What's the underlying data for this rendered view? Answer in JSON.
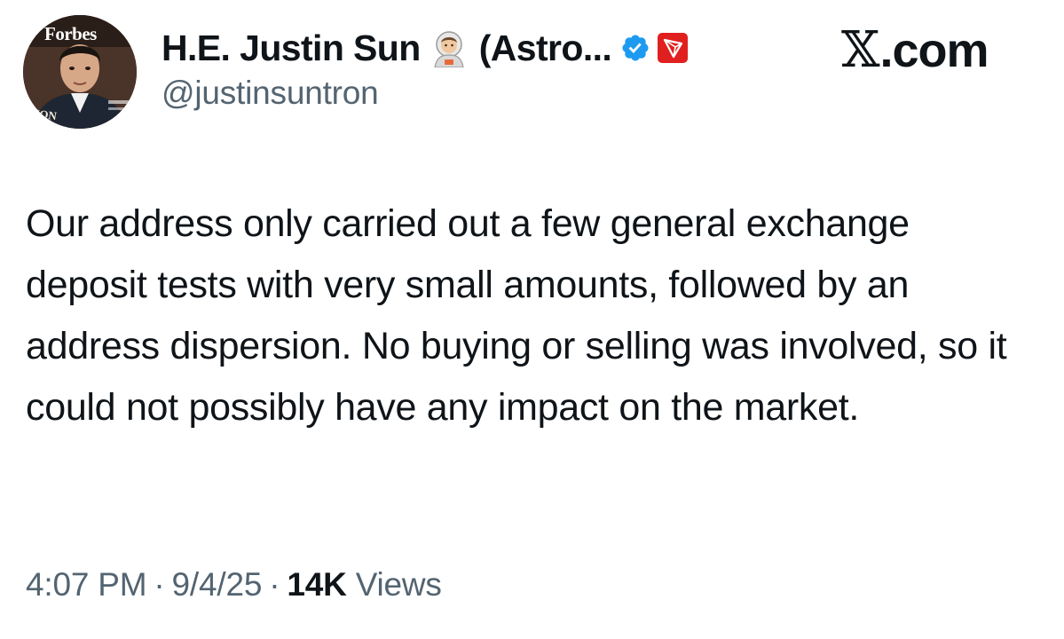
{
  "author": {
    "display_name": "H.E. Justin Sun",
    "name_suffix": "(Astro...",
    "handle": "@justinsuntron",
    "avatar": {
      "masthead": "Forbes",
      "cover_text": "RION"
    },
    "emoji_icon": "astronaut-emoji-icon",
    "verified_icon": "verified-badge-icon",
    "affiliate_icon": "tron-logo-icon"
  },
  "brand": {
    "glyph": "𝕏",
    "label": ".com"
  },
  "tweet": {
    "text": "Our address only carried out a few general exchange deposit tests with very small amounts, followed by an address dispersion. No buying or selling was involved, so it could not possibly have any impact on the market."
  },
  "meta": {
    "time": "4:07 PM",
    "separator": "·",
    "date": "9/4/25",
    "views_count": "14K",
    "views_label": "Views"
  },
  "colors": {
    "text": "#0f1419",
    "secondary": "#536471",
    "verified": "#1d9bf0",
    "tron_red": "#e0201f"
  }
}
